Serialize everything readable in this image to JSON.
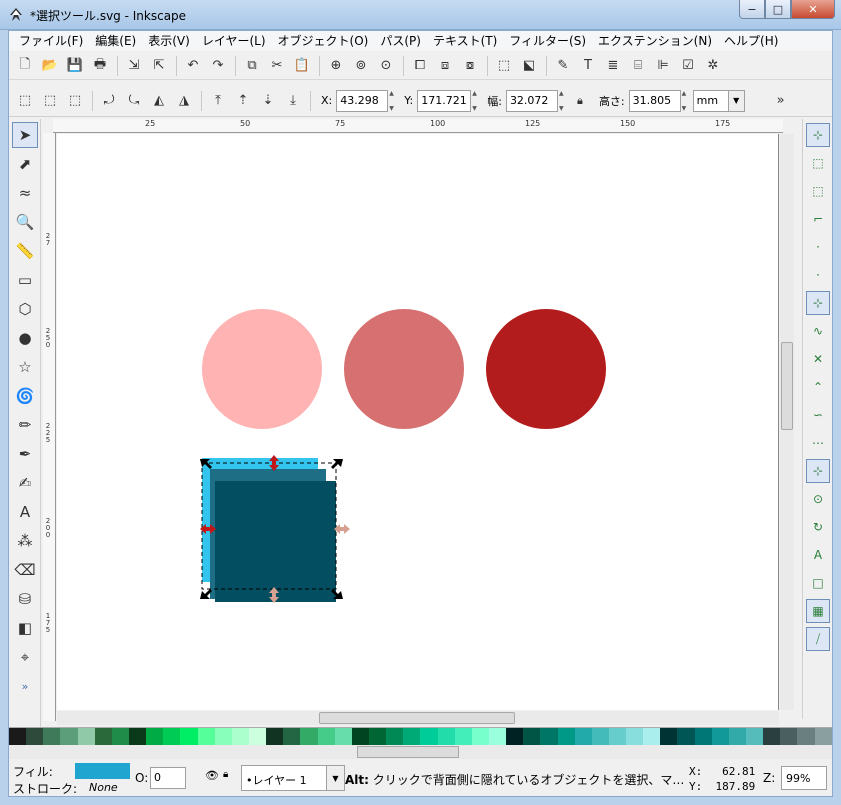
{
  "window": {
    "title": "*選択ツール.svg - Inkscape",
    "min": "−",
    "max": "□",
    "close": "✕"
  },
  "menu": [
    "ファイル(F)",
    "編集(E)",
    "表示(V)",
    "レイヤー(L)",
    "オブジェクト(O)",
    "パス(P)",
    "テキスト(T)",
    "フィルター(S)",
    "エクステンション(N)",
    "ヘルプ(H)"
  ],
  "toolbar1_icons": [
    "new-icon",
    "open-icon",
    "save-icon",
    "print-icon",
    "import-icon",
    "export-icon",
    "undo-icon",
    "redo-icon",
    "copy-icon",
    "cut-icon",
    "paste-icon",
    "zoom-selection-icon",
    "zoom-drawing-icon",
    "zoom-page-icon",
    "duplicate-icon",
    "clone-icon",
    "unlink-clone-icon",
    "group-icon",
    "ungroup-icon",
    "fill-stroke-icon",
    "text-font-icon",
    "layers-icon",
    "xml-editor-icon",
    "align-icon",
    "preferences-icon",
    "document-properties-icon"
  ],
  "toolbar1_glyphs": [
    "🗋",
    "📂",
    "💾",
    "🖶",
    "⇲",
    "⇱",
    "↶",
    "↷",
    "⧉",
    "✂",
    "📋",
    "⊕",
    "⊚",
    "⊙",
    "⧠",
    "⧈",
    "⧇",
    "⬚",
    "⬕",
    "✎",
    "T",
    "≣",
    "⌸",
    "⊫",
    "☑",
    "✲"
  ],
  "toolbar2_glyphs": [
    "⬚",
    "⬚",
    "⬚",
    "⤾",
    "⤿",
    "◭",
    "◮",
    "⤒",
    "⇡",
    "⇣",
    "⤓"
  ],
  "toolbar2_icons": [
    "select-all-icon",
    "select-all-layers-icon",
    "deselect-icon",
    "rotate-ccw-icon",
    "rotate-cw-icon",
    "flip-h-icon",
    "flip-v-icon",
    "raise-top-icon",
    "raise-icon",
    "lower-icon",
    "lower-bottom-icon"
  ],
  "transform": {
    "x_label": "X:",
    "x": "43.298",
    "y_label": "Y:",
    "y": "171.721",
    "w_label": "幅:",
    "w": "32.072",
    "lock_icon": "lock-icon",
    "h_label": "高さ:",
    "h": "31.805",
    "unit": "mm"
  },
  "more_glyph": "»",
  "tools": [
    {
      "name": "selector-tool",
      "glyph": "➤",
      "active": true
    },
    {
      "name": "node-tool",
      "glyph": "⬈"
    },
    {
      "name": "tweak-tool",
      "glyph": "≈"
    },
    {
      "name": "zoom-tool",
      "glyph": "🔍"
    },
    {
      "name": "measure-tool",
      "glyph": "📏"
    },
    {
      "name": "rect-tool",
      "glyph": "▭"
    },
    {
      "name": "3dbox-tool",
      "glyph": "⬡"
    },
    {
      "name": "ellipse-tool",
      "glyph": "●"
    },
    {
      "name": "star-tool",
      "glyph": "☆"
    },
    {
      "name": "spiral-tool",
      "glyph": "🌀"
    },
    {
      "name": "pencil-tool",
      "glyph": "✏"
    },
    {
      "name": "pen-tool",
      "glyph": "✒"
    },
    {
      "name": "calligraphy-tool",
      "glyph": "✍"
    },
    {
      "name": "text-tool",
      "glyph": "A"
    },
    {
      "name": "spray-tool",
      "glyph": "⁂"
    },
    {
      "name": "eraser-tool",
      "glyph": "⌫"
    },
    {
      "name": "bucket-tool",
      "glyph": "⛁"
    },
    {
      "name": "gradient-tool",
      "glyph": "◧"
    },
    {
      "name": "dropper-tool",
      "glyph": "⌖"
    }
  ],
  "tools_more": "»",
  "ruler": {
    "top_labels": [
      "25",
      "50",
      "75",
      "100",
      "125",
      "150",
      "175"
    ],
    "left_labels": [
      "2\n7",
      "2\n5\n0",
      "2\n2\n5",
      "2\n0\n0",
      "1\n7\n5"
    ]
  },
  "canvas": {
    "circles": [
      {
        "name": "light-pink-circle",
        "color": "#ffb3b3"
      },
      {
        "name": "medium-red-circle",
        "color": "#d77070"
      },
      {
        "name": "dark-red-circle",
        "color": "#b31c1c"
      }
    ],
    "squares": [
      {
        "name": "cyan-square",
        "color": "#33c5ee"
      },
      {
        "name": "teal-square",
        "color": "#1e6e86"
      },
      {
        "name": "dark-teal-square",
        "color": "#034e60"
      }
    ]
  },
  "snap_icons": [
    {
      "name": "snap-toggle-icon",
      "on": true
    },
    {
      "name": "snap-bbox-icon",
      "on": false
    },
    {
      "name": "snap-bbox-edge-icon",
      "on": false
    },
    {
      "name": "snap-bbox-corner-icon",
      "on": false
    },
    {
      "name": "snap-bbox-midpoint-icon",
      "on": false
    },
    {
      "name": "snap-bbox-center-icon",
      "on": false
    },
    {
      "name": "snap-nodes-icon",
      "on": true
    },
    {
      "name": "snap-path-icon",
      "on": false
    },
    {
      "name": "snap-intersection-icon",
      "on": false
    },
    {
      "name": "snap-cusp-icon",
      "on": false
    },
    {
      "name": "snap-smooth-icon",
      "on": false
    },
    {
      "name": "snap-midpoint-icon",
      "on": false
    },
    {
      "name": "snap-others-icon",
      "on": true
    },
    {
      "name": "snap-center-icon",
      "on": false
    },
    {
      "name": "snap-rotation-center-icon",
      "on": false
    },
    {
      "name": "snap-text-baseline-icon",
      "on": false
    },
    {
      "name": "snap-page-border-icon",
      "on": false
    },
    {
      "name": "snap-grid-icon",
      "on": true
    },
    {
      "name": "snap-guide-icon",
      "on": true
    }
  ],
  "palette": [
    "#1a1a1a",
    "#2e4a3a",
    "#3f7a5a",
    "#5c9e7a",
    "#8fc9a8",
    "#2a6a3a",
    "#1f8c4a",
    "#0a3a1a",
    "#00aa44",
    "#00cc55",
    "#00ee66",
    "#55ff99",
    "#88ffbb",
    "#aaffcc",
    "#ccffdd",
    "#113322",
    "#226644",
    "#33aa66",
    "#44cc88",
    "#66ddaa",
    "#004422",
    "#006633",
    "#008855",
    "#00aa77",
    "#00cc99",
    "#22ddaa",
    "#44eebb",
    "#77ffcc",
    "#99ffdd",
    "#002222",
    "#005544",
    "#007766",
    "#009988",
    "#22aaaa",
    "#44bbbb",
    "#66cccc",
    "#88dddd",
    "#aaeeee",
    "#003333",
    "#005555",
    "#007777",
    "#119999",
    "#33aaaa",
    "#55bbbb",
    "#2a3f3f",
    "#4a5f5f",
    "#6a7f7f",
    "#8a9f9f"
  ],
  "status": {
    "fill_label": "フィル:",
    "stroke_label": "ストローク:",
    "stroke_value": "None",
    "opacity_label": "O:",
    "opacity_value": "0",
    "layer": "•レイヤー 1",
    "message_bold": "Alt:",
    "message": " クリックで背面側に隠れているオブジェクトを選択、マ…",
    "x_label": "X:",
    "x": "62.81",
    "y_label": "Y:",
    "y": "187.89",
    "zoom_label": "Z:",
    "zoom": "99%"
  }
}
